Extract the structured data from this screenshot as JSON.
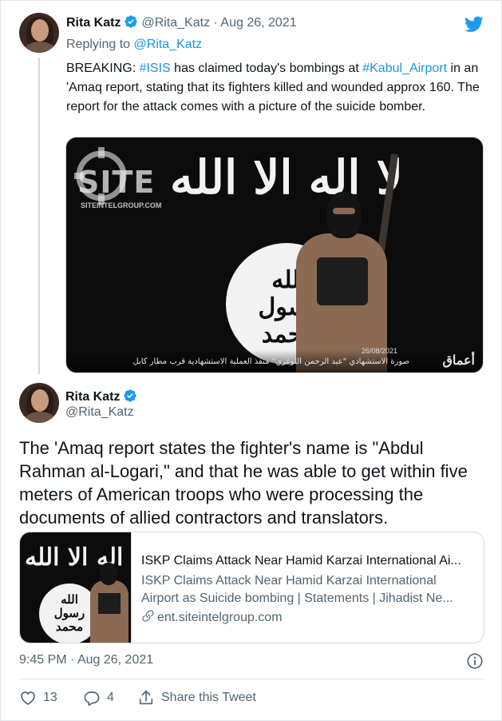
{
  "tweet_parent": {
    "author_name": "Rita Katz",
    "author_handle": "@Rita_Katz",
    "separator": "·",
    "date": "Aug 26, 2021",
    "replying_prefix": "Replying to ",
    "replying_to": "@Rita_Katz",
    "text_parts": {
      "p1": "BREAKING: ",
      "hashtag1": "#ISIS",
      "p2": " has claimed today's bombings at ",
      "hashtag2": "#Kabul_Airport",
      "p3": " in an 'Amaq report, stating that its fighters killed and wounded approx 160. The report for the attack comes with a picture of the suicide bomber."
    },
    "photo": {
      "watermark": "SITE",
      "watermark_url": "SITEINTELGROUP.COM",
      "photo_date": "26/08/2021",
      "caption": "صورة الاستشهادي \"عبد الرحمن اللوغري\" منفذ العملية الاستشهادية قرب مطار كابل",
      "agency_logo": "أعماق",
      "flag_script": "لا اله الا الله",
      "seal_line1": "الله",
      "seal_line2": "رسول",
      "seal_line3": "محمد"
    }
  },
  "tweet_main": {
    "author_name": "Rita Katz",
    "author_handle": "@Rita_Katz",
    "text": "The 'Amaq report states the fighter's name is \"Abdul Rahman al-Logari,\" and that he was able to get within five meters of American troops who were processing the documents of allied contractors and translators.",
    "card": {
      "title": "ISKP Claims Attack Near Hamid Karzai International Ai...",
      "description_line1": "ISKP Claims Attack Near Hamid Karzai International",
      "description_line2": "Airport as Suicide bombing | Statements | Jihadist Ne...",
      "domain": "ent.siteintelgroup.com"
    },
    "time": "9:45 PM",
    "meta_separator": "·",
    "date": "Aug 26, 2021"
  },
  "actions": {
    "like_count": "13",
    "reply_count": "4",
    "share_label": "Share this Tweet"
  },
  "icons": {
    "verified": "verified-badge-icon",
    "twitter": "twitter-bird-icon",
    "info": "info-icon",
    "like": "heart-icon",
    "reply": "reply-icon",
    "share": "share-icon",
    "link": "link-icon"
  },
  "colors": {
    "link_blue": "#1b95e0",
    "verified_blue": "#1d9bf0",
    "secondary_text": "#536471",
    "primary_text": "#0f1419",
    "border": "#cfd9de"
  }
}
